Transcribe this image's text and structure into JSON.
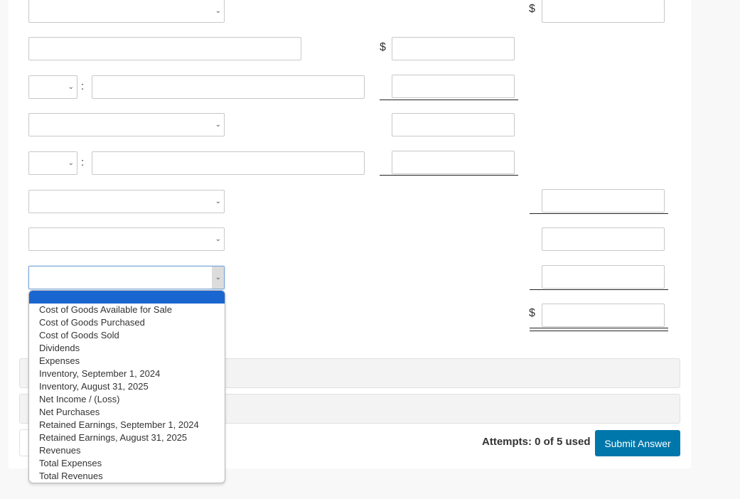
{
  "form": {
    "currency_symbol": "$",
    "ratio_separator": ":",
    "rows": [
      {
        "type": "select",
        "value": ""
      },
      {
        "type": "text",
        "value": ""
      },
      {
        "type": "select-small",
        "value": ""
      },
      {
        "type": "select",
        "value": ""
      },
      {
        "type": "select-small",
        "value": ""
      },
      {
        "type": "select",
        "value": ""
      },
      {
        "type": "select",
        "value": ""
      },
      {
        "type": "select",
        "value": "",
        "state": "open"
      }
    ]
  },
  "dropdown": {
    "selected": "",
    "options": [
      "Cost of Goods Available for Sale",
      "Cost of Goods Purchased",
      "Cost of Goods Sold",
      "Dividends",
      "Expenses",
      "Inventory, September 1, 2024",
      "Inventory, August 31, 2025",
      "Net Income / (Loss)",
      "Net Purchases",
      "Retained Earnings, September 1, 2024",
      "Retained Earnings, August 31, 2025",
      "Revenues",
      "Total Expenses",
      "Total Revenues"
    ]
  },
  "footer": {
    "attempts_text": "Attempts: 0 of 5 used",
    "submit_label": "Submit Answer"
  },
  "colors": {
    "submit_bg": "#0077aa",
    "dropdown_highlight": "#1a66d0"
  }
}
